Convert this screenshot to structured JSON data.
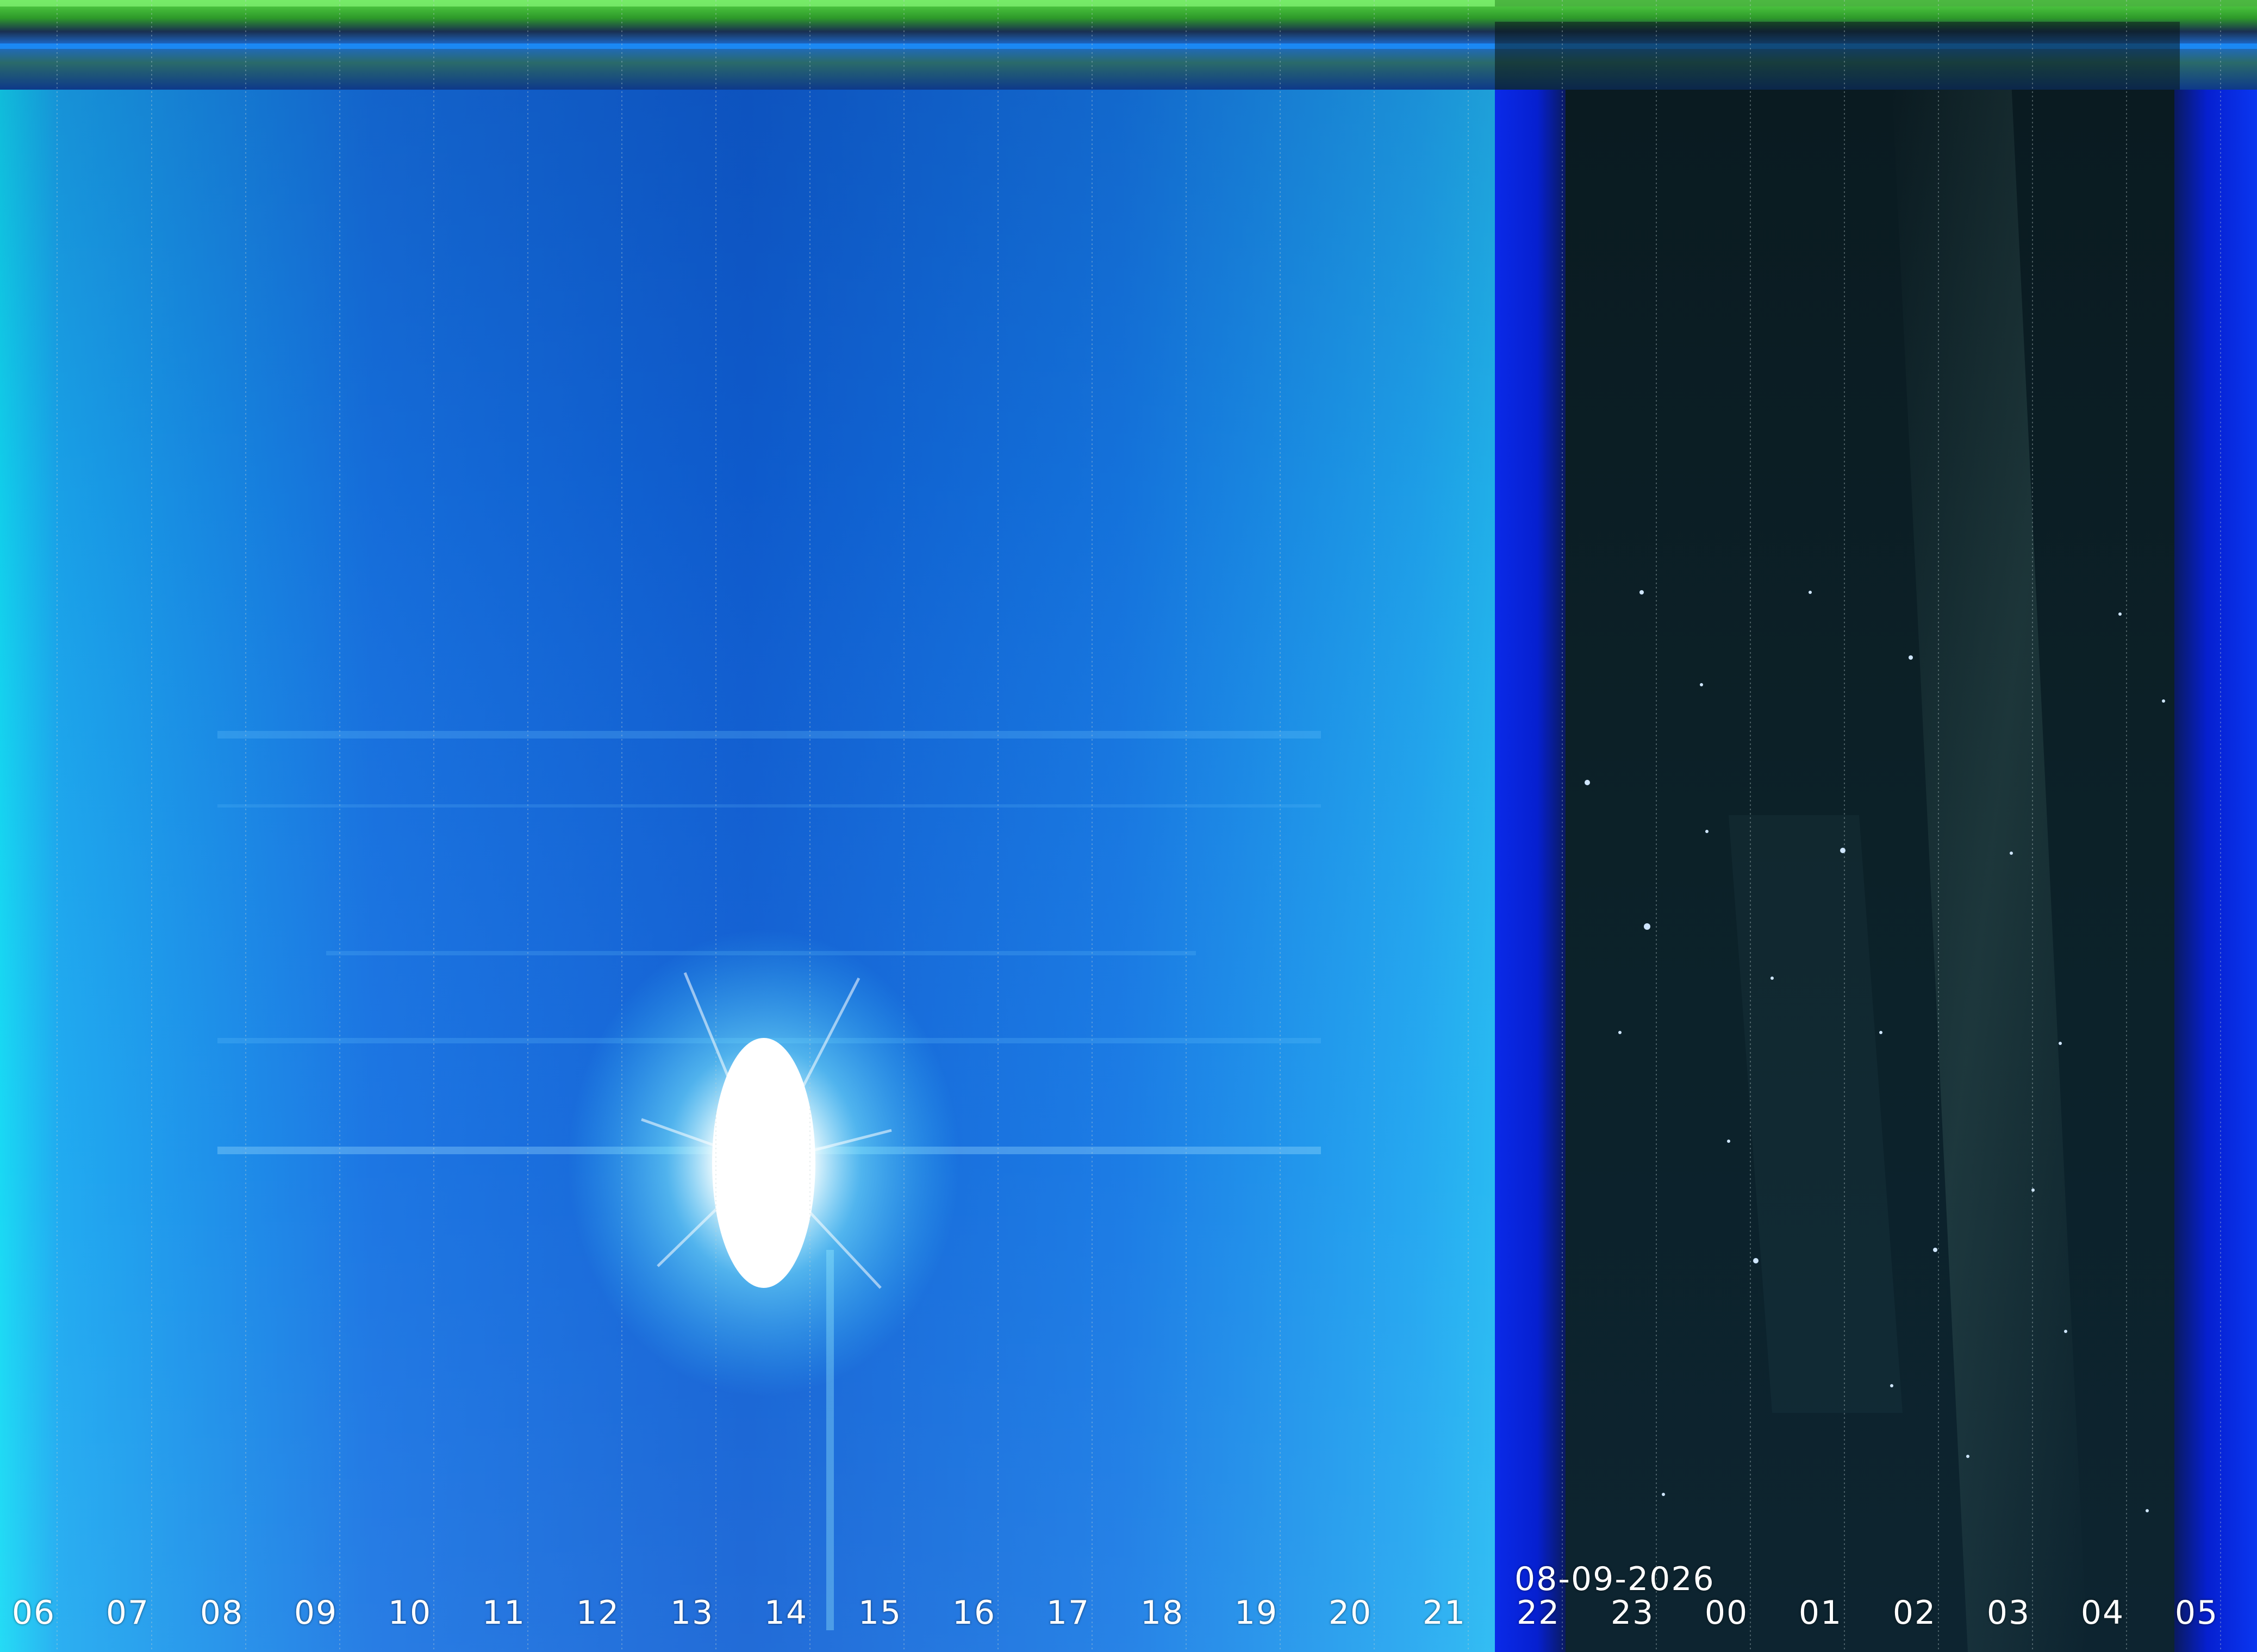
{
  "date_label": "08-09-2026",
  "hour_labels": [
    "06",
    "07",
    "08",
    "09",
    "10",
    "11",
    "12",
    "13",
    "14",
    "15",
    "16",
    "17",
    "18",
    "19",
    "20",
    "21",
    "22",
    "23",
    "00",
    "01",
    "02",
    "03",
    "04",
    "05"
  ],
  "colors": {
    "day_sky": "#1f8fe6",
    "day_sky_dark": "#0f5fd0",
    "twilight_blue": "#0622e8",
    "night_sky": "#0b2026",
    "sun_glow": "#ffffff",
    "top_band_green": "#3fc13a",
    "grid_line": "#b8c8c8"
  },
  "icons": {
    "sun": "sun-glare"
  }
}
